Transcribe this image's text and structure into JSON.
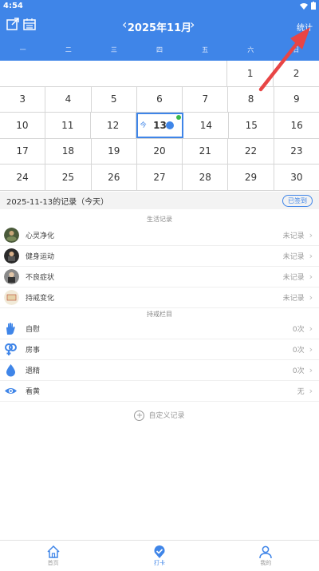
{
  "status_bar": {
    "time": "4:54",
    "wifi_icon": "wifi-icon",
    "battery_icon": "battery-icon"
  },
  "header": {
    "month_title": "2025年11月",
    "stats_label": "统计"
  },
  "weekdays": [
    "一",
    "二",
    "三",
    "四",
    "五",
    "六",
    "日"
  ],
  "calendar": {
    "rows": [
      [
        "",
        "",
        "",
        "",
        "",
        "1",
        "2"
      ],
      [
        "3",
        "4",
        "5",
        "6",
        "7",
        "8",
        "9"
      ],
      [
        "10",
        "11",
        "12",
        "13",
        "14",
        "15",
        "16"
      ],
      [
        "17",
        "18",
        "19",
        "20",
        "21",
        "22",
        "23"
      ],
      [
        "24",
        "25",
        "26",
        "27",
        "28",
        "29",
        "30"
      ]
    ],
    "today": "13",
    "today_marker": "今"
  },
  "record_header": {
    "title": "2025-11-13的记录（今天）",
    "signed_label": "已签到"
  },
  "life_section": {
    "title": "生活记录",
    "items": [
      {
        "label": "心灵净化",
        "value": "未记录"
      },
      {
        "label": "健身运动",
        "value": "未记录"
      },
      {
        "label": "不良症状",
        "value": "未记录"
      },
      {
        "label": "持戒变化",
        "value": "未记录"
      }
    ]
  },
  "abstain_section": {
    "title": "持戒栏目",
    "items": [
      {
        "label": "自慰",
        "value": "0次",
        "icon": "hand-icon"
      },
      {
        "label": "房事",
        "value": "0次",
        "icon": "gender-icon"
      },
      {
        "label": "遗精",
        "value": "0次",
        "icon": "drop-icon"
      },
      {
        "label": "看黄",
        "value": "无",
        "icon": "eye-icon"
      }
    ]
  },
  "custom_record_label": "自定义记录",
  "bottom_nav": [
    {
      "label": "首页",
      "icon": "home-icon"
    },
    {
      "label": "打卡",
      "icon": "checkin-icon"
    },
    {
      "label": "我的",
      "icon": "user-icon"
    }
  ],
  "colors": {
    "accent": "#3f85e8",
    "pointer": "#e84545"
  }
}
